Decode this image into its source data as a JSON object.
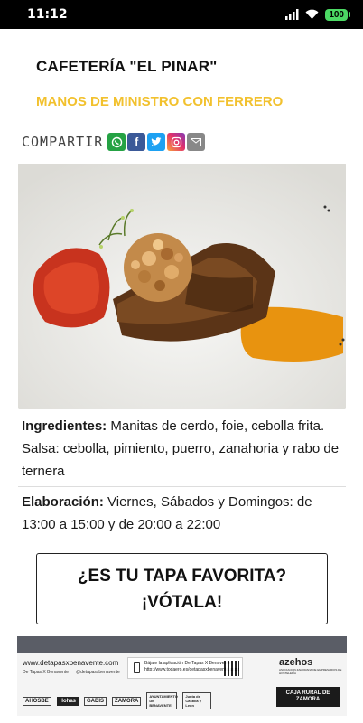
{
  "status_bar": {
    "time": "11:12",
    "signal_icon": "signal-icon",
    "wifi_icon": "wifi-icon",
    "battery": "100"
  },
  "header": {
    "title": "CAFETERÍA \"EL PINAR\"",
    "subtitle": "MANOS DE MINISTRO CON FERRERO"
  },
  "colors": {
    "subtitle": "#f2c12e",
    "footer_band": "#5a5d66"
  },
  "share": {
    "label": "COMPARTIR",
    "icons": [
      "whatsapp-icon",
      "facebook-icon",
      "twitter-icon",
      "instagram-icon",
      "email-icon"
    ]
  },
  "details": {
    "ingredients_label": "Ingredientes:",
    "ingredients_text": " Manitas de cerdo, foie, cebolla frita. Salsa: cebolla, pimiento, puerro, zanahoria y rabo de ternera",
    "elaboration_label": "Elaboración:",
    "elaboration_text": " Viernes, Sábados y Domingos: de 13:00 a 15:00 y de 20:00 a 22:00"
  },
  "vote_button": {
    "line1": "¿ES TU TAPA FAVORITA?",
    "line2": "¡VÓTALA!"
  },
  "footer": {
    "website": "www.detapasxbenavente.com",
    "social_1": "De Tapas X Benavente",
    "social_2": "@detapasxbenavente",
    "app_line1": "Bájate la aplicación De Tapas X Benavente",
    "app_line2": "http://www.todaero.es/detapasxbenavente.aspx",
    "azehos": "azehos",
    "azehos_sub": "ASOCIACIÓN ZAMORANA DE EMPRESARIOS DE HOSTELERÍA",
    "logos": [
      "AHOSBE",
      "Hohas",
      "GADIS",
      "ZAMORA",
      "AYUNTAMIENTO DE BENAVENTE",
      "Junta de Castilla y León"
    ],
    "caja": "CAJA RURAL DE ZAMORA"
  }
}
